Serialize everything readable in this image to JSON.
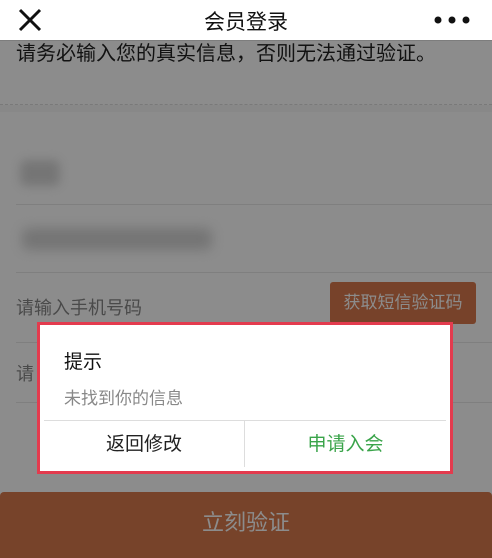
{
  "topbar": {
    "title": "会员登录",
    "close_icon": "close-icon",
    "more_icon": "more-icon"
  },
  "notice": {
    "text": "请务必输入您的真实信息，否则无法通过验证。"
  },
  "form": {
    "phone_placeholder": "请输入手机号码",
    "get_code_label": "获取短信验证码",
    "code_placeholder": "请"
  },
  "submit": {
    "label": "立刻验证"
  },
  "dialog": {
    "title": "提示",
    "message": "未找到你的信息",
    "back_label": "返回修改",
    "apply_label": "申请入会"
  },
  "colors": {
    "accent": "#d9794d",
    "apply_green": "#3aa44a",
    "highlight_border": "#e33b4e"
  }
}
